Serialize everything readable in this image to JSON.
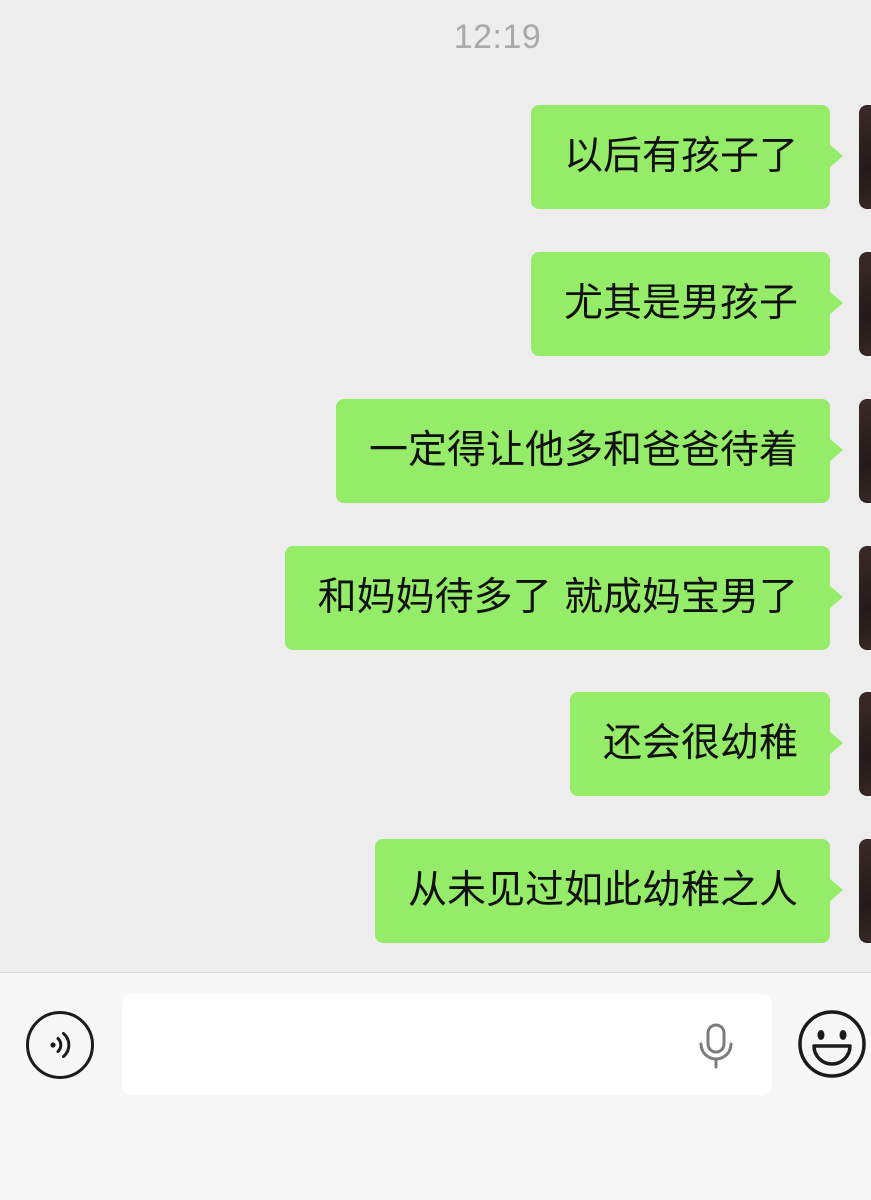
{
  "chat": {
    "timestamp": "12:19",
    "messages": [
      {
        "text": "以后有孩子了"
      },
      {
        "text": "尤其是男孩子"
      },
      {
        "text": "一定得让他多和爸爸待着"
      },
      {
        "text": "和妈妈待多了 就成妈宝男了"
      },
      {
        "text": "还会很幼稚"
      },
      {
        "text": "从未见过如此幼稚之人"
      }
    ]
  },
  "input_bar": {
    "voice_icon": "voice-mode-icon",
    "text_value": "",
    "mic_icon": "microphone-icon",
    "emoji_icon": "emoji-smile-icon"
  },
  "colors": {
    "background": "#ededed",
    "bubble_sent": "#95ec69",
    "timestamp": "#a9a9a9",
    "input_bar": "#f7f7f7"
  }
}
